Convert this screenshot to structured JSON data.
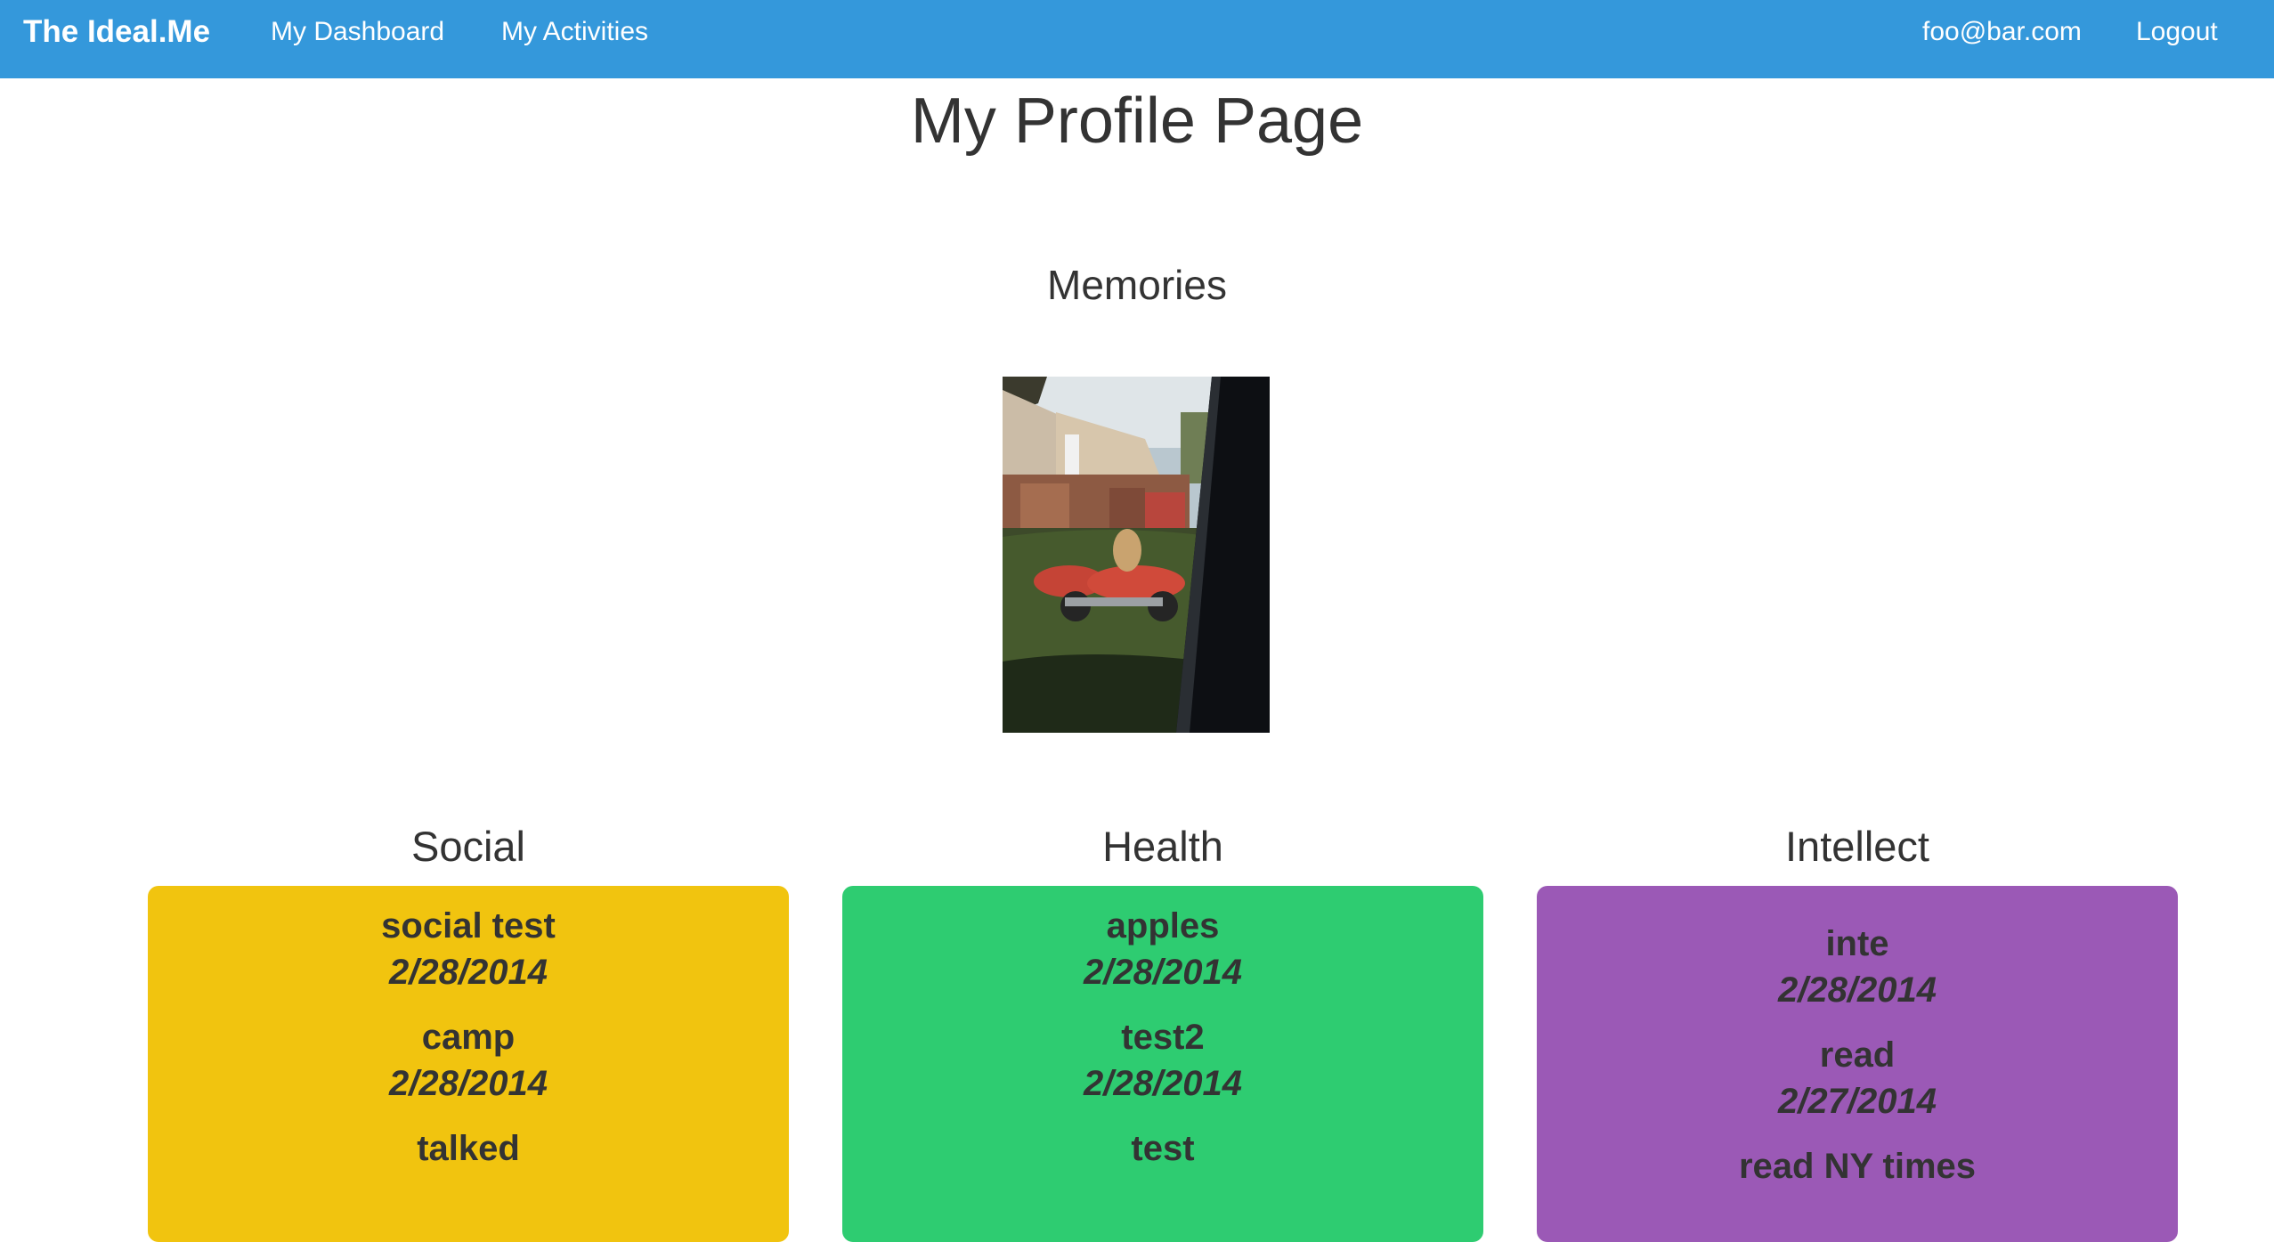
{
  "nav": {
    "brand": "The Ideal.Me",
    "dashboard": "My Dashboard",
    "activities": "My Activities",
    "email": "foo@bar.com",
    "logout": "Logout"
  },
  "page": {
    "title": "My Profile Page",
    "memories_heading": "Memories"
  },
  "colors": {
    "navbar": "#3498db",
    "social": "#f1c40f",
    "health": "#2ecc71",
    "intellect": "#9b59b6"
  },
  "categories": {
    "social": {
      "title": "Social",
      "entries": [
        {
          "name": "social test",
          "date": "2/28/2014"
        },
        {
          "name": "camp",
          "date": "2/28/2014"
        },
        {
          "name": "talked",
          "date": ""
        }
      ]
    },
    "health": {
      "title": "Health",
      "entries": [
        {
          "name": "apples",
          "date": "2/28/2014"
        },
        {
          "name": "test2",
          "date": "2/28/2014"
        },
        {
          "name": "test",
          "date": ""
        }
      ]
    },
    "intellect": {
      "title": "Intellect",
      "entries": [
        {
          "name": "inte",
          "date": "2/28/2014"
        },
        {
          "name": "read",
          "date": "2/27/2014"
        },
        {
          "name": "read NY times",
          "date": ""
        }
      ]
    }
  }
}
